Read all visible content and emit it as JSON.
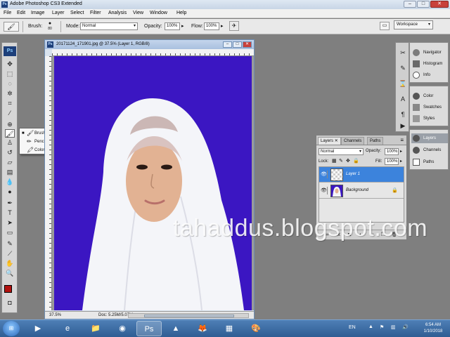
{
  "titlebar": {
    "app_icon": "Ps",
    "title": "Adobe Photoshop CS3 Extended"
  },
  "menubar": {
    "items": [
      "File",
      "Edit",
      "Image",
      "Layer",
      "Select",
      "Filter",
      "Analysis",
      "View",
      "Window",
      "Help"
    ]
  },
  "options": {
    "brush_label": "Brush:",
    "brush_size": "80",
    "mode_label": "Mode:",
    "mode_value": "Normal",
    "opacity_label": "Opacity:",
    "opacity_value": "100%",
    "flow_label": "Flow:",
    "flow_value": "100%",
    "workspace_label": "Workspace"
  },
  "toolbox": {
    "logo": "Ps",
    "foreground_color": "#b2120f",
    "background_color": "#ffffff"
  },
  "flyout": {
    "items": [
      {
        "label": "Brush Tool",
        "shortcut": "B",
        "icon": "brush-icon",
        "selected": true
      },
      {
        "label": "Pencil Tool",
        "shortcut": "B",
        "icon": "pencil-icon",
        "selected": false
      },
      {
        "label": "Color Replacement Tool",
        "shortcut": "B",
        "icon": "color-replacement-icon",
        "selected": false
      }
    ]
  },
  "document": {
    "icon": "Ps",
    "title": "20171124_171901.jpg @ 37.5% (Layer 1, RGB/8)",
    "zoom": "37.5%",
    "doc_info": "Doc: 5.25M/5.07M",
    "canvas_background": "#3b16c2"
  },
  "right_panels": {
    "group1": [
      "Navigator",
      "Histogram",
      "Info"
    ],
    "group2": [
      "Color",
      "Swatches",
      "Styles"
    ],
    "group3": [
      "Layers",
      "Channels",
      "Paths"
    ]
  },
  "layers_panel": {
    "tabs": [
      "Layers",
      "Channels",
      "Paths"
    ],
    "blend_mode": "Normal",
    "opacity_label": "Opacity:",
    "opacity_value": "100%",
    "lock_label": "Lock:",
    "fill_label": "Fill:",
    "fill_value": "100%",
    "layers": [
      {
        "name": "Layer 1",
        "selected": true
      },
      {
        "name": "Background",
        "selected": false,
        "locked": true
      }
    ]
  },
  "watermark": "tahaddus.blogspot.com",
  "taskbar": {
    "pinned": [
      "media-player-icon",
      "ie-icon",
      "explorer-icon",
      "chrome-icon",
      "photoshop-icon",
      "vlc-icon",
      "firefox-icon",
      "winrar-icon",
      "paint-icon"
    ],
    "language": "EN",
    "time": "6:54 AM",
    "date": "1/10/2018"
  }
}
